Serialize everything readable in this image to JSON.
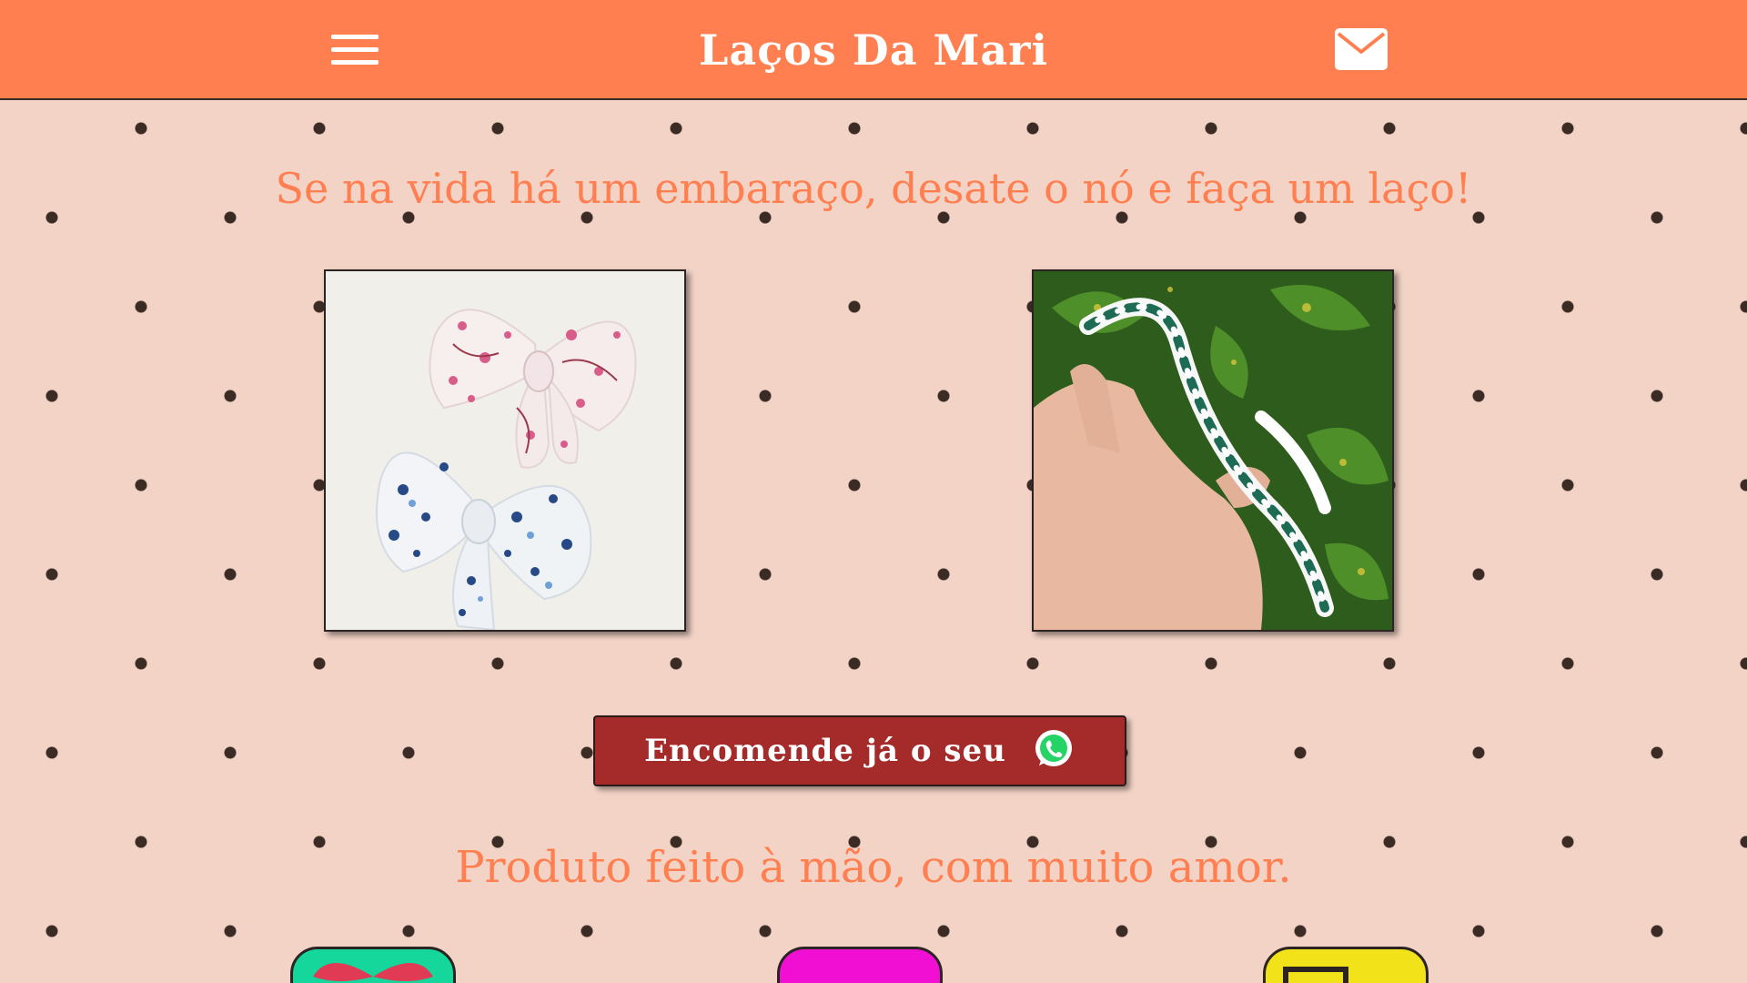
{
  "header": {
    "title": "Laços Da Mari",
    "menu_icon": "hamburger-menu-icon",
    "mail_icon": "mail-icon"
  },
  "main": {
    "slogan": "Se na vida há um embaraço, desate o nó e faça um laço!",
    "products": [
      {
        "image": "fabric-bows-photo"
      },
      {
        "image": "pearl-headband-photo"
      }
    ],
    "cta": {
      "label": "Encomende já o seu",
      "icon": "whatsapp-icon"
    },
    "tagline": "Produto feito à mão, com muito amor."
  },
  "category_tabs": [
    {
      "color": "#15d79b",
      "icon": "bow-icon"
    },
    {
      "color": "#f20fd4",
      "icon": "tab-icon"
    },
    {
      "color": "#f1e219",
      "icon": "box-icon"
    }
  ],
  "colors": {
    "header": "#ff7f50",
    "background": "#f3d3c6",
    "dots": "#3b2b25",
    "cta": "#a52a2a",
    "accent_text": "#ff7f50"
  }
}
